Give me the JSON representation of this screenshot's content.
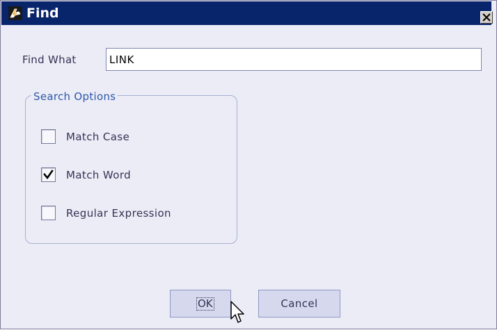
{
  "window": {
    "title": "Find",
    "icon": "binoculars-icon",
    "close_glyph": "close-icon"
  },
  "find": {
    "label": "Find What",
    "value": "LINK"
  },
  "search_options": {
    "legend": "Search Options",
    "items": [
      {
        "label": "Match Case",
        "checked": false
      },
      {
        "label": "Match Word",
        "checked": true
      },
      {
        "label": "Regular Expression",
        "checked": false
      }
    ]
  },
  "buttons": {
    "ok": "OK",
    "cancel": "Cancel"
  },
  "colors": {
    "titlebar": "#08246b",
    "dialog_bg": "#ececf6",
    "accent_text": "#2c57a8",
    "button_bg": "#d6d9ee"
  }
}
